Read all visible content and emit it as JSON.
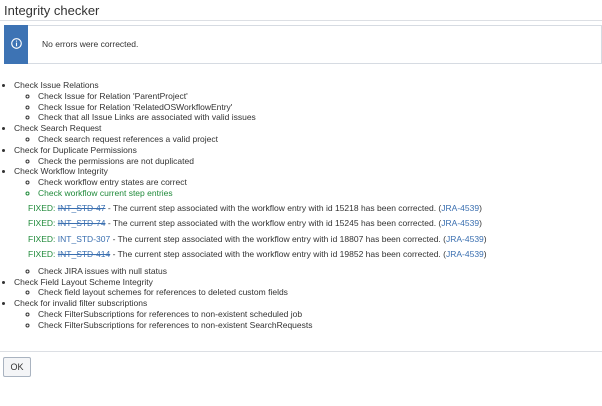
{
  "dialog": {
    "title": "Integrity checker",
    "notice": {
      "icon": "info-icon",
      "text": "No errors were corrected.",
      "bar_color": "#3d73b4"
    }
  },
  "checks": [
    {
      "label": "Check Issue Relations",
      "items": [
        "Check Issue for Relation 'ParentProject'",
        "Check Issue for Relation 'RelatedOSWorkflowEntry'",
        "Check that all Issue Links are associated with valid issues"
      ]
    },
    {
      "label": "Check Search Request",
      "items": [
        "Check search request references a valid project"
      ]
    },
    {
      "label": "Check for Duplicate Permissions",
      "items": [
        "Check the permissions are not duplicated"
      ]
    },
    {
      "label": "Check Workflow Integrity",
      "items": [
        "Check workflow entry states are correct",
        "Check workflow current step entries",
        "Check JIRA issues with null status"
      ],
      "fixed": [
        {
          "label": "FIXED:",
          "issue": "INT_STD-47",
          "struck": true,
          "message": " - The current step associated with the workflow entry with id 15218 has been corrected. (",
          "ref": "JRA-4539",
          "close": ")"
        },
        {
          "label": "FIXED:",
          "issue": "INT_STD-74",
          "struck": true,
          "message": " - The current step associated with the workflow entry with id 15245 has been corrected. (",
          "ref": "JRA-4539",
          "close": ")"
        },
        {
          "label": "FIXED:",
          "issue": "INT_STD-307",
          "struck": false,
          "message": " - The current step associated with the workflow entry with id 18807 has been corrected. (",
          "ref": "JRA-4539",
          "close": ")"
        },
        {
          "label": "FIXED:",
          "issue": "INT_STD-414",
          "struck": true,
          "message": " - The current step associated with the workflow entry with id 19852 has been corrected. (",
          "ref": "JRA-4539",
          "close": ")"
        }
      ]
    },
    {
      "label": "Check Field Layout Scheme Integrity",
      "items": [
        "Check field layout schemes for references to deleted custom fields"
      ]
    },
    {
      "label": "Check for invalid filter subscriptions",
      "items": [
        "Check FilterSubscriptions for references to non-existent scheduled job",
        "Check FilterSubscriptions for references to non-existent SearchRequests"
      ]
    }
  ],
  "footer": {
    "ok_label": "OK"
  },
  "colors": {
    "accent": "#3d73b4",
    "fixed_green": "#1f8a3a",
    "link_blue": "#3a6fb0"
  }
}
